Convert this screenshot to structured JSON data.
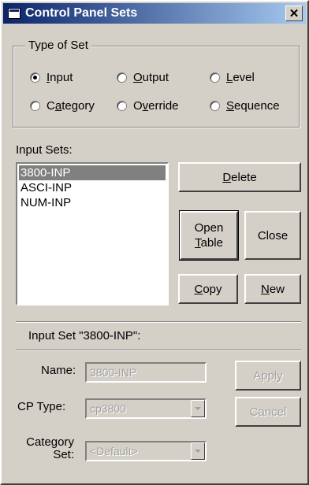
{
  "window": {
    "title": "Control Panel Sets",
    "close_symbol": "✕"
  },
  "type_of_set": {
    "label": "Type of Set",
    "options": [
      {
        "pre": "",
        "key": "I",
        "post": "nput",
        "checked": true
      },
      {
        "pre": "",
        "key": "O",
        "post": "utput",
        "checked": false
      },
      {
        "pre": "",
        "key": "L",
        "post": "evel",
        "checked": false
      },
      {
        "pre": "C",
        "key": "a",
        "post": "tegory",
        "checked": false
      },
      {
        "pre": "O",
        "key": "v",
        "post": "erride",
        "checked": false
      },
      {
        "pre": "",
        "key": "S",
        "post": "equence",
        "checked": false
      }
    ]
  },
  "input_sets": {
    "label": "Input Sets:",
    "items": [
      {
        "label": "3800-INP",
        "selected": true
      },
      {
        "label": "ASCI-INP",
        "selected": false
      },
      {
        "label": "NUM-INP",
        "selected": false
      }
    ]
  },
  "buttons": {
    "delete": {
      "key": "D",
      "rest": "elete"
    },
    "open_table": {
      "line1": "Open",
      "key": "T",
      "rest": "able"
    },
    "close": "Close",
    "copy": {
      "key": "C",
      "rest": "opy"
    },
    "new": {
      "key": "N",
      "rest": "ew"
    },
    "apply": "Apply",
    "cancel": "Cancel"
  },
  "details": {
    "header": "Input Set \"3800-INP\":",
    "name_label": "Name:",
    "name_value": "3800-INP",
    "cp_type_label": "CP Type:",
    "cp_type_value": "cp3800",
    "category_label_1": "Category",
    "category_label_2": "Set:",
    "category_value": "<Default>"
  }
}
